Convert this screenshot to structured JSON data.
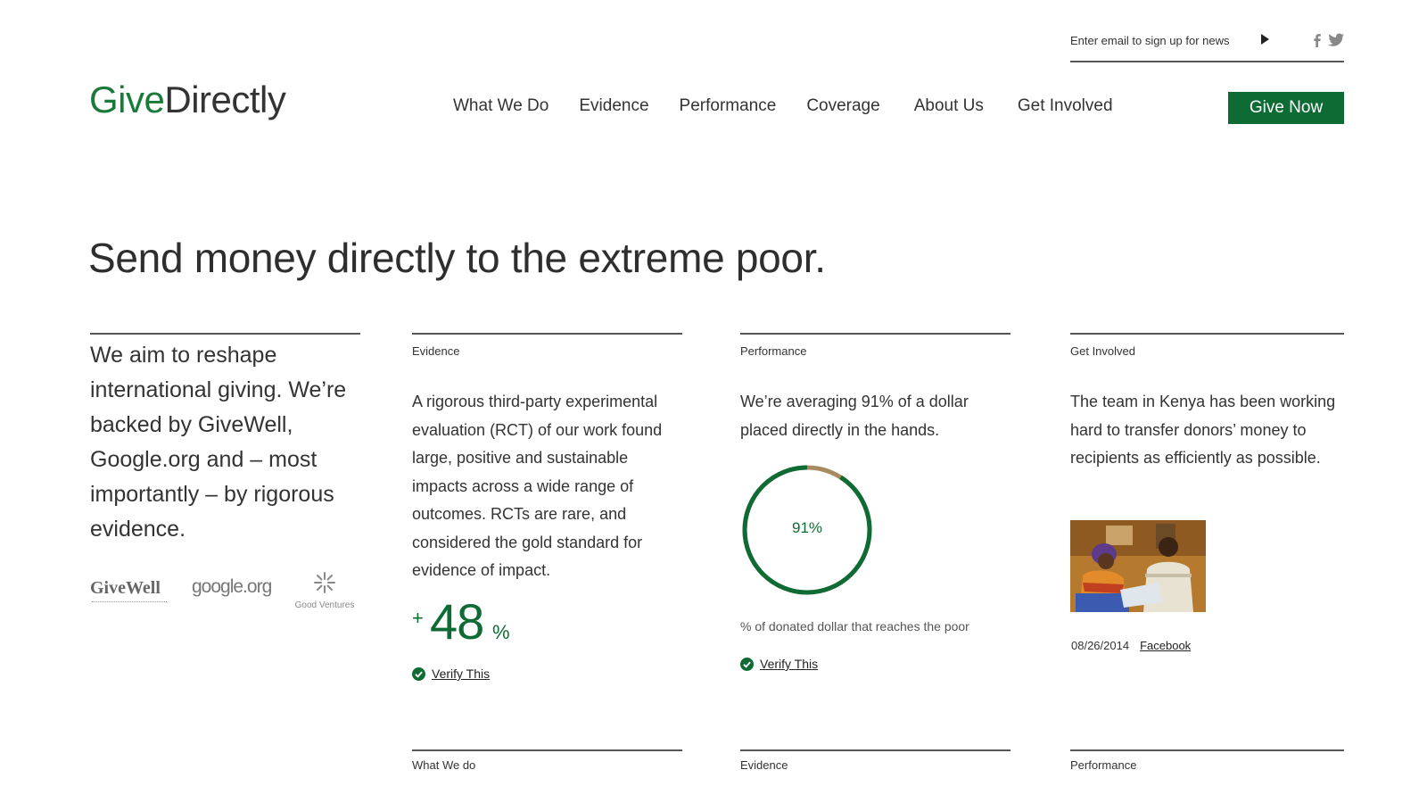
{
  "signup": {
    "placeholder": "Enter email to sign up for news"
  },
  "social": {
    "facebook_icon": "facebook-icon",
    "twitter_icon": "twitter-icon"
  },
  "logo": {
    "part1": "Give",
    "part2": "Directly"
  },
  "nav": {
    "items": [
      {
        "label": "What We Do"
      },
      {
        "label": "Evidence"
      },
      {
        "label": "Performance"
      },
      {
        "label": "Coverage"
      },
      {
        "label": "About Us"
      },
      {
        "label": "Get Involved"
      }
    ]
  },
  "give_now": {
    "label": "Give Now"
  },
  "hero": {
    "title": "Send money directly to the extreme poor."
  },
  "intro": {
    "text": "We aim to reshape international giving. We’re backed by GiveWell, Google.org and – most importantly – by rigorous evidence.",
    "partners": {
      "givewell": "GiveWell",
      "google": "google.org",
      "goodventures": "Good Ventures"
    }
  },
  "evidence": {
    "label": "Evidence",
    "body": "A rigorous third-party experimental evaluation (RCT) of our work found large, positive and sustainable impacts across a wide range of outcomes. RCTs are rare, and considered the gold standard for evidence of impact.",
    "stat_plus": "+",
    "stat_value": "48",
    "stat_unit": "%",
    "verify_label": "Verify This"
  },
  "performance": {
    "label": "Performance",
    "body": "We’re averaging 91% of a dollar placed directly in the hands.",
    "ring_value": 0.91,
    "ring_label": "91%",
    "caption": "% of donated dollar that reaches the poor",
    "verify_label": "Verify This"
  },
  "get_involved": {
    "label": "Get Involved",
    "body": "The team in Kenya has been working hard to transfer donors’ money to recipients as efficiently as possible.",
    "date": "08/26/2014",
    "link": "Facebook"
  },
  "bottom": {
    "labels": [
      "What We do",
      "Evidence",
      "Performance"
    ]
  },
  "colors": {
    "brand_green": "#0e6b33",
    "logo_green": "#1a7a3a",
    "ring_tan": "#a88a5e"
  }
}
